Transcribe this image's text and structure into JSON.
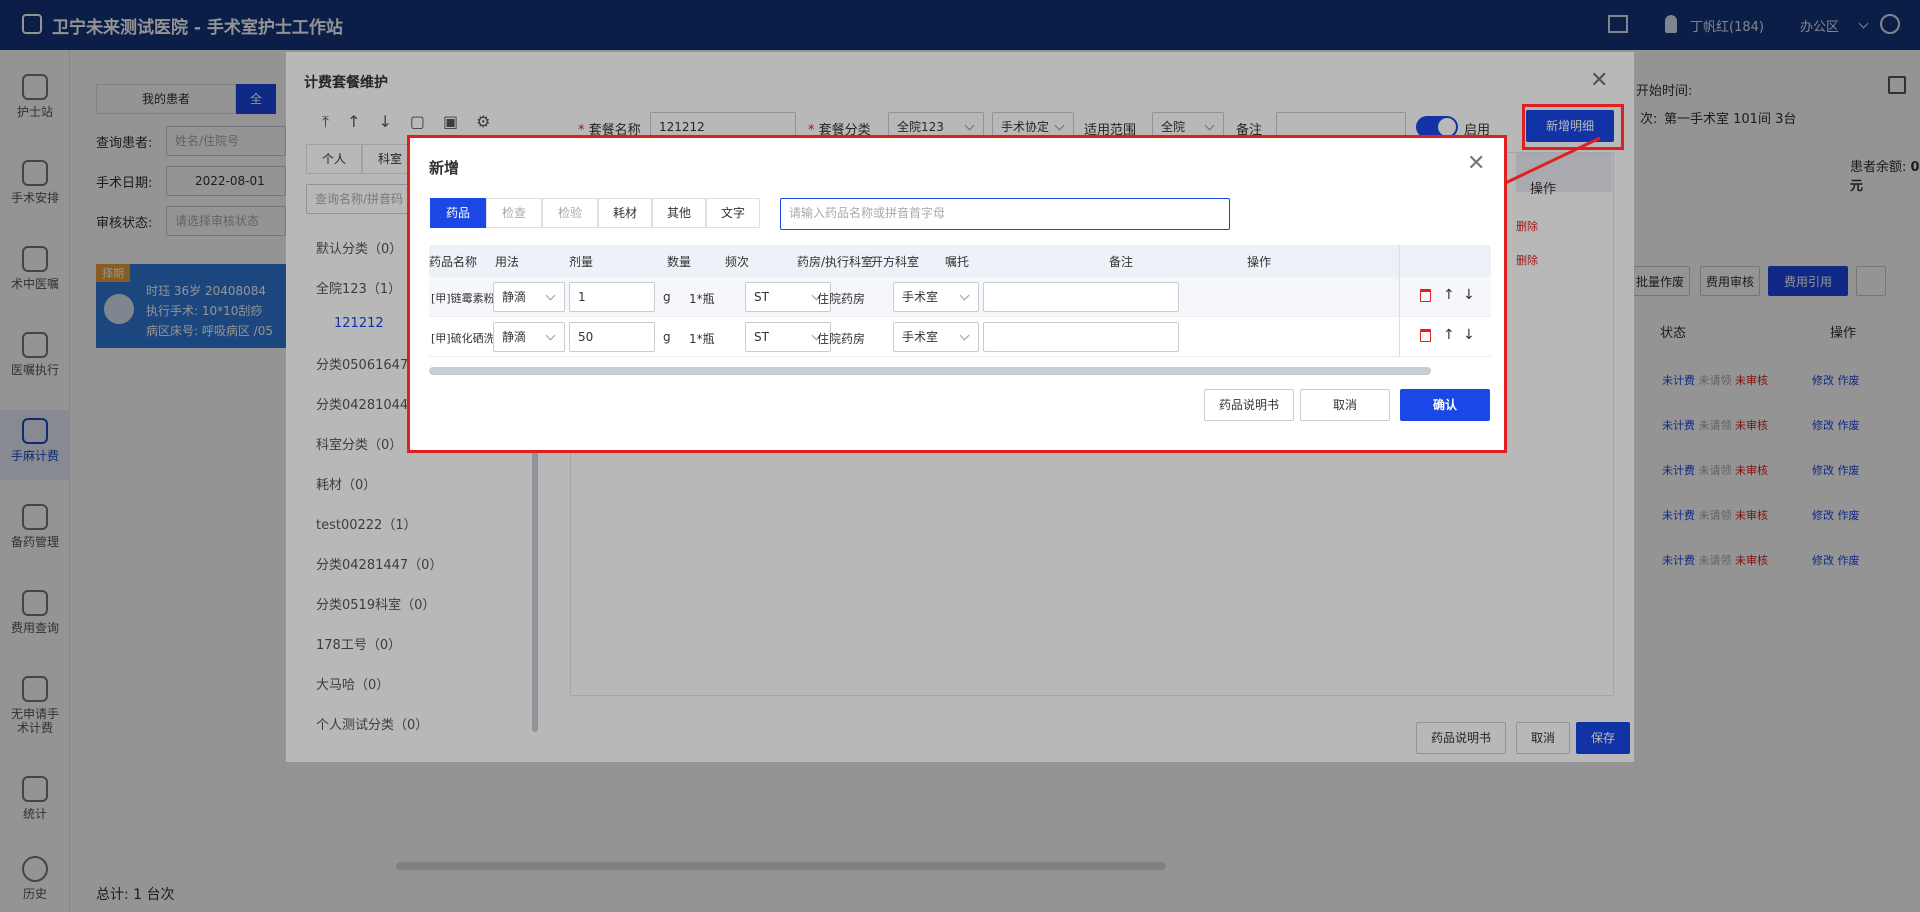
{
  "header": {
    "title": "卫宁未来测试医院 - 手术室护士工作站",
    "user": "丁帆红(184)",
    "office": "办公区"
  },
  "nav": [
    {
      "label": "护士站"
    },
    {
      "label": "手术安排"
    },
    {
      "label": "术中医嘱"
    },
    {
      "label": "医嘱执行"
    },
    {
      "label": "手麻计费"
    },
    {
      "label": "备药管理"
    },
    {
      "label": "费用查询"
    },
    {
      "label": "无申请手术计费"
    },
    {
      "label": "统计"
    },
    {
      "label": "历史"
    }
  ],
  "bg": {
    "tab_my": "我的患者",
    "tab_all": "全",
    "q_patient": "查询患者:",
    "q_patient_ph": "姓名/住院号",
    "q_date": "手术日期:",
    "q_date_val": "2022-08-01",
    "q_status": "审核状态:",
    "q_status_ph": "请选择审核状态",
    "badge": "择期",
    "patient_name": "时珏",
    "patient_age": "36岁",
    "patient_id": "20408084",
    "patient_op": "执行手术: 10*10刮痧",
    "patient_ward": "病区床号: 呼吸病区 /05",
    "start_time": "开始时间:",
    "room": "第一手术室 101间 3台",
    "room_label": "次:",
    "balance": "患者余额:",
    "balance_val": "0 元",
    "total": "总计:  1 台次",
    "col_status": "状态",
    "col_op": "操作",
    "status_a": "未计费",
    "status_b": "未请领",
    "status_c": "未审核",
    "act_edit": "修改",
    "act_void": "作废",
    "btn_void": "批量作废",
    "btn_review": "费用审核",
    "btn_ref": "费用引用"
  },
  "panel": {
    "title": "计费套餐维护",
    "tab_personal": "个人",
    "tab_dept": "科室",
    "search_ph": "查询名称/拼音码",
    "name_label": "套餐名称",
    "name_val": "121212",
    "cat_label": "套餐分类",
    "cat_val": "全院123",
    "cat2_val": "手术协定",
    "scope_label": "适用范围",
    "scope_val": "全院",
    "remark_label": "备注",
    "enable_label": "启用",
    "add_detail": "新增明细",
    "col_op": "操作",
    "del": "删除",
    "drug_manual": "药品说明书",
    "cancel": "取消",
    "save": "保存",
    "categories": [
      {
        "label": "默认分类（0）"
      },
      {
        "label": "全院123（1）"
      },
      {
        "label": "121212"
      },
      {
        "label": "分类05061647"
      },
      {
        "label": "分类04281044"
      },
      {
        "label": "科室分类（0）"
      },
      {
        "label": "耗材（0）"
      },
      {
        "label": "test00222（1）"
      },
      {
        "label": "分类04281447（0）"
      },
      {
        "label": "分类0519科室（0）"
      },
      {
        "label": "178工号（0）"
      },
      {
        "label": "大马哈（0）"
      },
      {
        "label": "个人测试分类（0）"
      }
    ]
  },
  "dialog": {
    "title": "新增",
    "tabs": [
      {
        "label": "药品"
      },
      {
        "label": "检查"
      },
      {
        "label": "检验"
      },
      {
        "label": "耗材"
      },
      {
        "label": "其他"
      },
      {
        "label": "文字"
      }
    ],
    "search_ph": "请输入药品名称或拼音首字母",
    "columns": [
      "药品名称",
      "用法",
      "剂量",
      "数量",
      "频次",
      "药房/执行科室",
      "开方科室",
      "嘱托",
      "备注",
      "操作"
    ],
    "rows": [
      {
        "name": "[甲]链霉素粉针",
        "usage": "静滴",
        "dose": "1",
        "unit": "g",
        "qty": "1*瓶",
        "freq": "ST",
        "pharmacy": "住院药房",
        "dept": "手术室"
      },
      {
        "name": "[甲]硫化硒洗剂",
        "usage": "静滴",
        "dose": "50",
        "unit": "g",
        "qty": "1*瓶",
        "freq": "ST",
        "pharmacy": "住院药房",
        "dept": "手术室"
      }
    ],
    "btn_manual": "药品说明书",
    "btn_cancel": "取消",
    "btn_confirm": "确认"
  },
  "colors": {
    "brand": "#14357a",
    "primary": "#1a47e6",
    "highlight": "#e02020"
  }
}
